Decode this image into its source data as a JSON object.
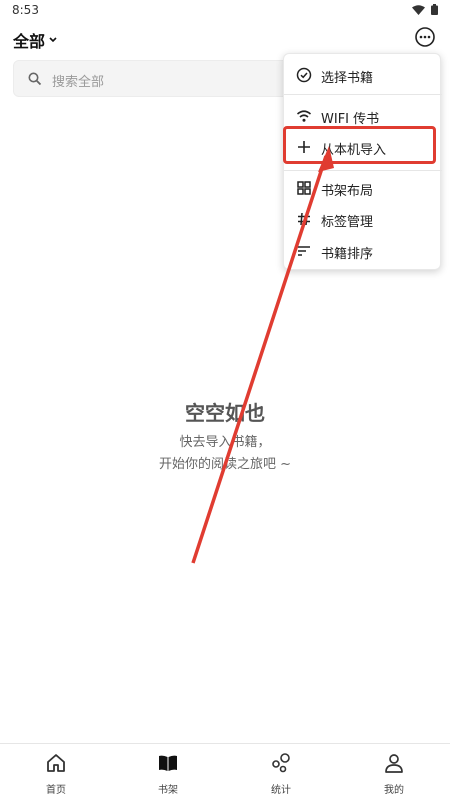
{
  "status_bar": {
    "time": "8:53"
  },
  "header": {
    "filter_label": "全部"
  },
  "search": {
    "placeholder": "搜索全部"
  },
  "empty_state": {
    "title": "空空如也",
    "line1": "快去导入书籍，",
    "line2": "开始你的阅读之旅吧 ~"
  },
  "menu": {
    "items": [
      {
        "label": "选择书籍",
        "icon": "check-circle-icon"
      },
      {
        "label": "WIFI 传书",
        "icon": "wifi-icon"
      },
      {
        "label": "从本机导入",
        "icon": "plus-icon"
      },
      {
        "label": "书架布局",
        "icon": "grid-icon"
      },
      {
        "label": "标签管理",
        "icon": "hash-icon"
      },
      {
        "label": "书籍排序",
        "icon": "sort-icon"
      }
    ]
  },
  "annotation": {
    "color": "#e03c31"
  },
  "bottom_nav": {
    "items": [
      {
        "label": "首页",
        "icon": "home-icon"
      },
      {
        "label": "书架",
        "icon": "book-icon"
      },
      {
        "label": "统计",
        "icon": "stats-icon"
      },
      {
        "label": "我的",
        "icon": "profile-icon"
      }
    ]
  }
}
